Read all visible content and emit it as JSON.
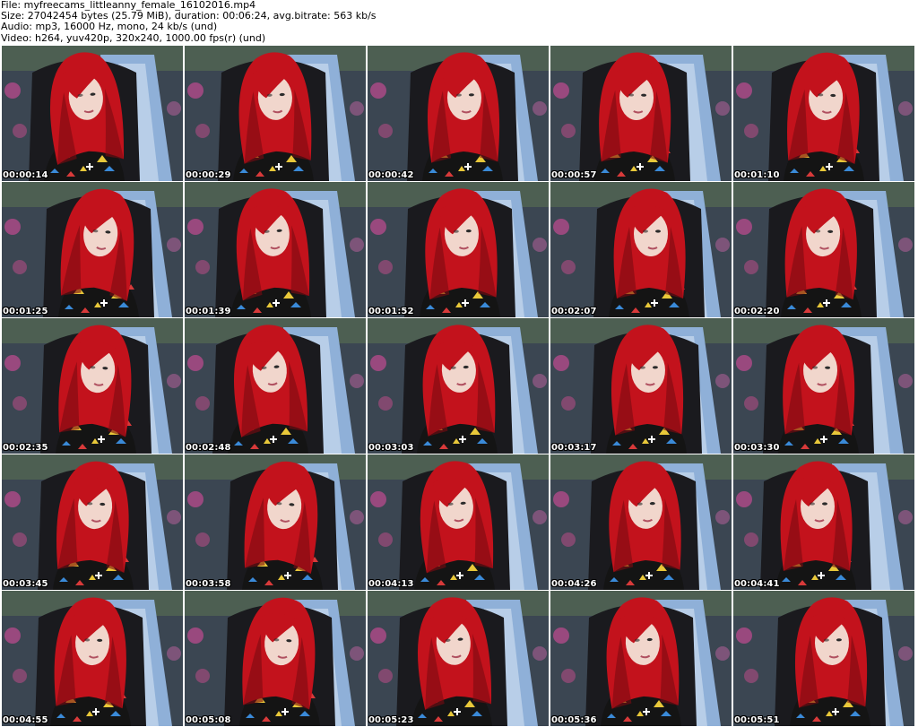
{
  "header": {
    "file_line": "File: myfreecams_littleanny_female_16102016.mp4",
    "size_line": "Size: 27042454 bytes (25.79 MiB), duration: 00:06:24, avg.bitrate: 563 kb/s",
    "audio_line": "Audio: mp3, 16000 Hz, mono, 24 kb/s (und)",
    "video_line": "Video: h264, yuv420p, 320x240, 1000.00 fps(r) (und)"
  },
  "thumbnails": [
    {
      "timestamp": "00:00:14"
    },
    {
      "timestamp": "00:00:29"
    },
    {
      "timestamp": "00:00:42"
    },
    {
      "timestamp": "00:00:57"
    },
    {
      "timestamp": "00:01:10"
    },
    {
      "timestamp": "00:01:25"
    },
    {
      "timestamp": "00:01:39"
    },
    {
      "timestamp": "00:01:52"
    },
    {
      "timestamp": "00:02:07"
    },
    {
      "timestamp": "00:02:20"
    },
    {
      "timestamp": "00:02:35"
    },
    {
      "timestamp": "00:02:48"
    },
    {
      "timestamp": "00:03:03"
    },
    {
      "timestamp": "00:03:17"
    },
    {
      "timestamp": "00:03:30"
    },
    {
      "timestamp": "00:03:45"
    },
    {
      "timestamp": "00:03:58"
    },
    {
      "timestamp": "00:04:13"
    },
    {
      "timestamp": "00:04:26"
    },
    {
      "timestamp": "00:04:41"
    },
    {
      "timestamp": "00:04:55"
    },
    {
      "timestamp": "00:05:08"
    },
    {
      "timestamp": "00:05:23"
    },
    {
      "timestamp": "00:05:36"
    },
    {
      "timestamp": "00:05:51"
    }
  ],
  "colors": {
    "hair": "#c3121c",
    "hair_dark": "#7a0a10",
    "skin": "#f1d6cc",
    "waterfall": "#8fb0d8",
    "rock": "#3b4652",
    "chair": "#1a1a1e",
    "shirt": "#141414"
  }
}
